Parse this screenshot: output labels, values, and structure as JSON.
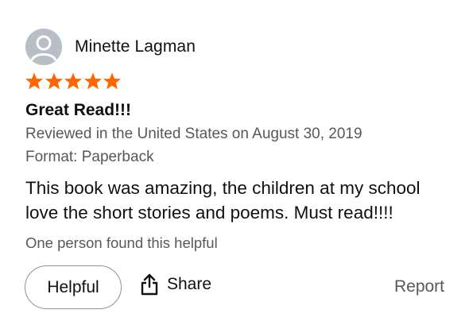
{
  "review": {
    "reviewer_name": "Minette Lagman",
    "rating": 5,
    "rating_max": 5,
    "title": "Great Read!!!",
    "date_line": "Reviewed in the United States on August 30, 2019",
    "format_line": "Format: Paperback",
    "body": "This book was amazing, the children at my school love the short stories and poems. Must read!!!!",
    "helpful_count_text": "One person found this helpful"
  },
  "actions": {
    "helpful_label": "Helpful",
    "share_label": "Share",
    "report_label": "Report"
  },
  "icons": {
    "avatar": "user-silhouette-icon",
    "star": "star-icon",
    "share": "share-upload-icon"
  },
  "colors": {
    "star": "#ff6600",
    "avatar_bg": "#b8bec5",
    "secondary_text": "#565959",
    "primary_text": "#0f1111"
  }
}
